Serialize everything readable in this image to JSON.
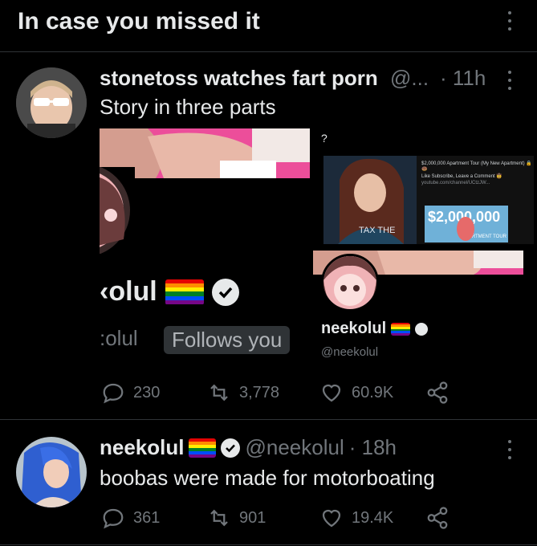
{
  "header": {
    "title": "In case you missed it"
  },
  "tweets": [
    {
      "name": "stonetoss watches fart porn",
      "handle_time": "@...",
      "time": "· 11h",
      "text": "Story in three parts",
      "actions": {
        "replies": "230",
        "retweets": "3,778",
        "likes": "60.9K"
      },
      "media": {
        "question_mark": "?",
        "crop_name": "‹olul",
        "crop_handle": ":olul",
        "follows_label": "Follows you",
        "profile_name": "neekolul",
        "profile_handle": "@neekolul",
        "youtube_caption": {
          "title": "$2,000,000 Apartment Tour (My New Apartment) 🔒🍩",
          "line2": "Like Subscribe, Leave a Comment 🤠",
          "line3": "youtube.com/channel/UCtzJW...",
          "thumb_price": "$2,000,000",
          "thumb_sub": "APARTMENT TOUR",
          "shirt_text": "TAX THE"
        }
      }
    },
    {
      "name": "neekolul",
      "handle_time": "@neekolul",
      "time": "· 18h",
      "text": "boobas were made for motorboating",
      "actions": {
        "replies": "361",
        "retweets": "901",
        "likes": "19.4K"
      }
    }
  ],
  "colors": {
    "background": "#000000",
    "text": "#e7e9ea",
    "muted": "#71767b",
    "divider": "#2f3336"
  }
}
